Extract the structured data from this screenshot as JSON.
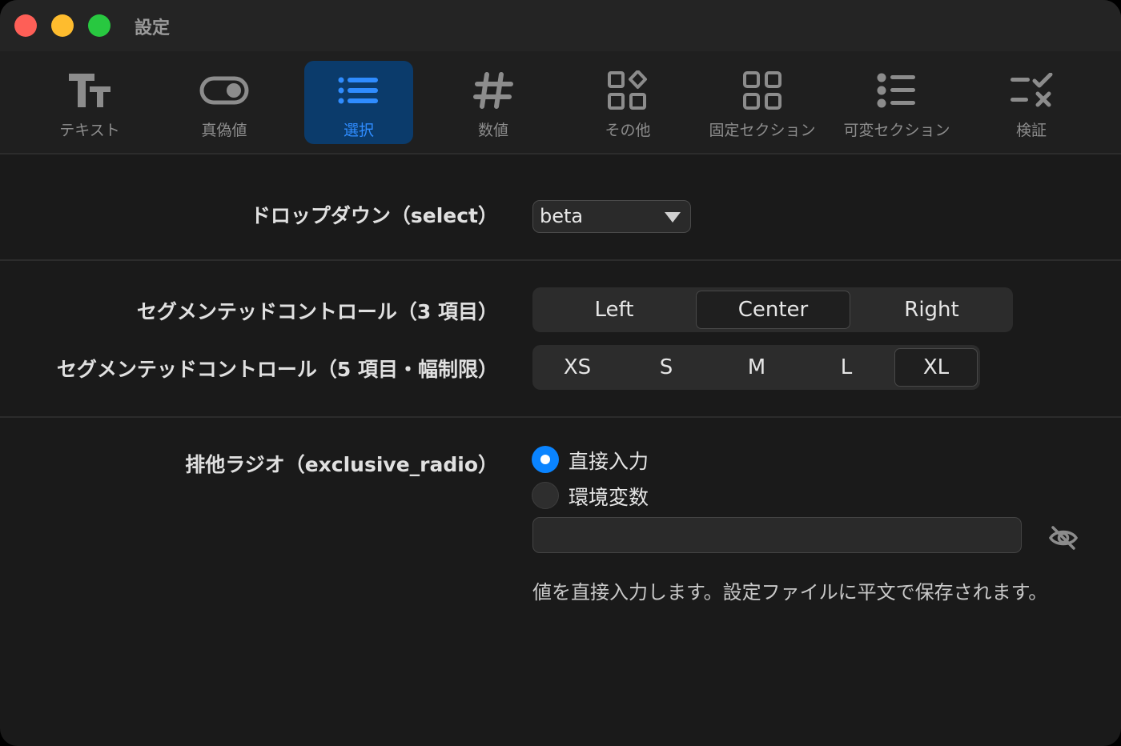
{
  "window": {
    "title": "設定"
  },
  "toolbar": {
    "items": [
      {
        "label": "テキスト",
        "icon": "text-format-icon"
      },
      {
        "label": "真偽値",
        "icon": "toggle-icon"
      },
      {
        "label": "選択",
        "icon": "list-icon"
      },
      {
        "label": "数値",
        "icon": "number-sign-icon"
      },
      {
        "label": "その他",
        "icon": "squares-diamond-icon"
      },
      {
        "label": "固定セクション",
        "icon": "grid-icon"
      },
      {
        "label": "可変セクション",
        "icon": "bullet-list-icon"
      },
      {
        "label": "検証",
        "icon": "checklist-icon"
      }
    ],
    "active_index": 2
  },
  "dropdown": {
    "label": "ドロップダウン（select）",
    "value": "beta"
  },
  "segment3": {
    "label": "セグメンテッドコントロール（3 項目）",
    "items": [
      "Left",
      "Center",
      "Right"
    ],
    "selected": "Center"
  },
  "segment5": {
    "label": "セグメンテッドコントロール（5 項目・幅制限）",
    "items": [
      "XS",
      "S",
      "M",
      "L",
      "XL"
    ],
    "selected": "XL"
  },
  "radio": {
    "label": "排他ラジオ（exclusive_radio）",
    "options": [
      "直接入力",
      "環境変数"
    ],
    "selected": "直接入力",
    "input_value": "",
    "help": "値を直接入力します。設定ファイルに平文で保存されます。"
  },
  "colors": {
    "accent": "#0a84ff",
    "active_tab_bg": "#0b3b6b",
    "active_tab_text": "#2f8cff"
  }
}
